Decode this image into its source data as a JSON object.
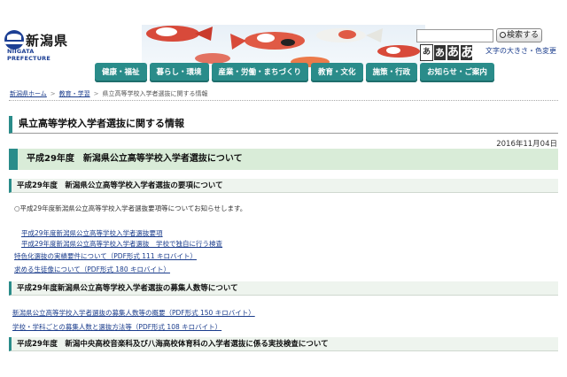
{
  "header": {
    "logo_title": "新潟県",
    "logo_sub": "NIIGATA PREFECTURE",
    "search_button": "検索する",
    "font_size_samples": [
      "あ",
      "あ",
      "あ",
      "あ"
    ],
    "font_color_link": "文字の大きさ・色変更"
  },
  "nav": [
    {
      "label": "健康・福祉"
    },
    {
      "label": "暮らし・環境"
    },
    {
      "label": "産業・労働・まちづくり"
    },
    {
      "label": "教育・文化"
    },
    {
      "label": "施策・行政"
    },
    {
      "label": "お知らせ・ご案内"
    }
  ],
  "breadcrumb": {
    "home": "新潟県ホーム",
    "section": "教育・学習",
    "current": "県立高等学校入学者選抜に関する情報"
  },
  "page": {
    "title": "県立高等学校入学者選抜に関する情報",
    "date": "2016年11月04日",
    "section_heading": "平成29年度　新潟県公立高等学校入学者選抜について"
  },
  "subsections": [
    {
      "heading": "平成29年度　新潟県公立高等学校入学者選抜の要項について",
      "intro": "○平成29年度新潟県公立高等学校入学者選抜要項等についてお知らせします。",
      "links": [
        "平成29年度新潟県公立高等学校入学者選抜要項",
        "平成29年度新潟県公立高等学校入学者選抜　学校で独自に行う検査",
        "特色化選抜の実績要件について（PDF形式  111 キロバイト）",
        "求める生徒像について（PDF形式  180 キロバイト）"
      ]
    },
    {
      "heading": "平成29年度新潟県公立高等学校入学者選抜の募集人数等について",
      "links": [
        "新潟県公立高等学校入学者選抜の募集人数等の概要（PDF形式  150 キロバイト）",
        "学校・学科ごとの募集人数と選抜方法等（PDF形式  108 キロバイト）"
      ]
    },
    {
      "heading": "平成29年度　新潟中央高校音楽科及び八海高校体育科の入学者選抜に係る実技検査について"
    }
  ],
  "colors": {
    "accent": "#2a8c8a",
    "link": "#1a3c8c",
    "section_bg": "#d9ecd8"
  }
}
